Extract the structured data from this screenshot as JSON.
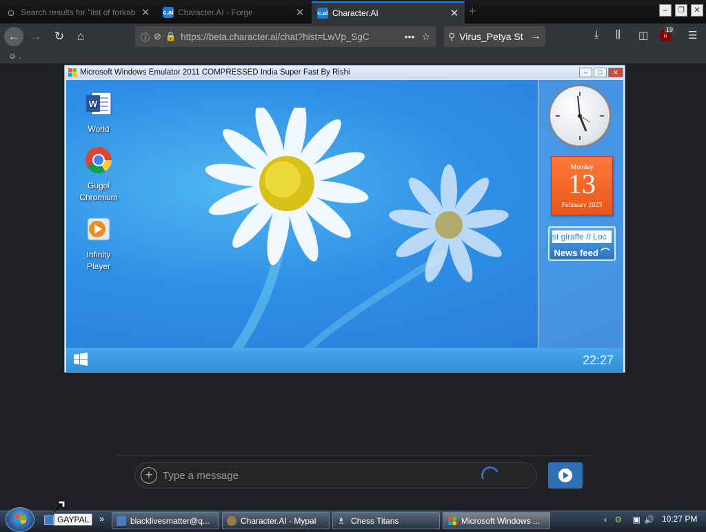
{
  "browser": {
    "tabs": [
      {
        "title": "Search results for \"list of forkab",
        "icon": "ghost-icon",
        "active": false
      },
      {
        "title": "Character.AI - Forge",
        "icon": "characterai-icon",
        "active": false
      },
      {
        "title": "Character.AI",
        "icon": "characterai-icon",
        "active": true
      }
    ],
    "new_tab": "+",
    "url": "https://beta.character.ai/chat?hist=LwVp_SgC",
    "search_text": "Virus_Petya St",
    "ublock_count": "19",
    "bookmark_label": "."
  },
  "emulator": {
    "title": "Microsoft Windows Emulator 2011 COMPRESSED India Super Fast By Rishi",
    "desktop_icons": [
      {
        "label_1": "World",
        "label_2": ""
      },
      {
        "label_1": "Gugol",
        "label_2": "Chromium"
      },
      {
        "label_1": "Infinity",
        "label_2": "Player"
      }
    ],
    "calendar": {
      "day": "Monday",
      "date": "13",
      "month": "February 2023"
    },
    "news": {
      "ticker": "st giraffe // Loc",
      "label": "News feed"
    },
    "clock": "22:27"
  },
  "chat": {
    "placeholder": "Type a message"
  },
  "taskbar": {
    "tooltip": "GAYPAL",
    "overflow": "»",
    "buttons": [
      {
        "label": "blacklivesmatter@q...",
        "active": false
      },
      {
        "label": "Character.AI - Mypal",
        "active": false
      },
      {
        "label": "Chess Titans",
        "active": false
      },
      {
        "label": "Microsoft Windows ...",
        "active": true
      }
    ],
    "time": "10:27 PM"
  },
  "colors": {
    "accent": "#0a84ff",
    "send": "#2e6fb5",
    "calendar": "#e85618"
  }
}
